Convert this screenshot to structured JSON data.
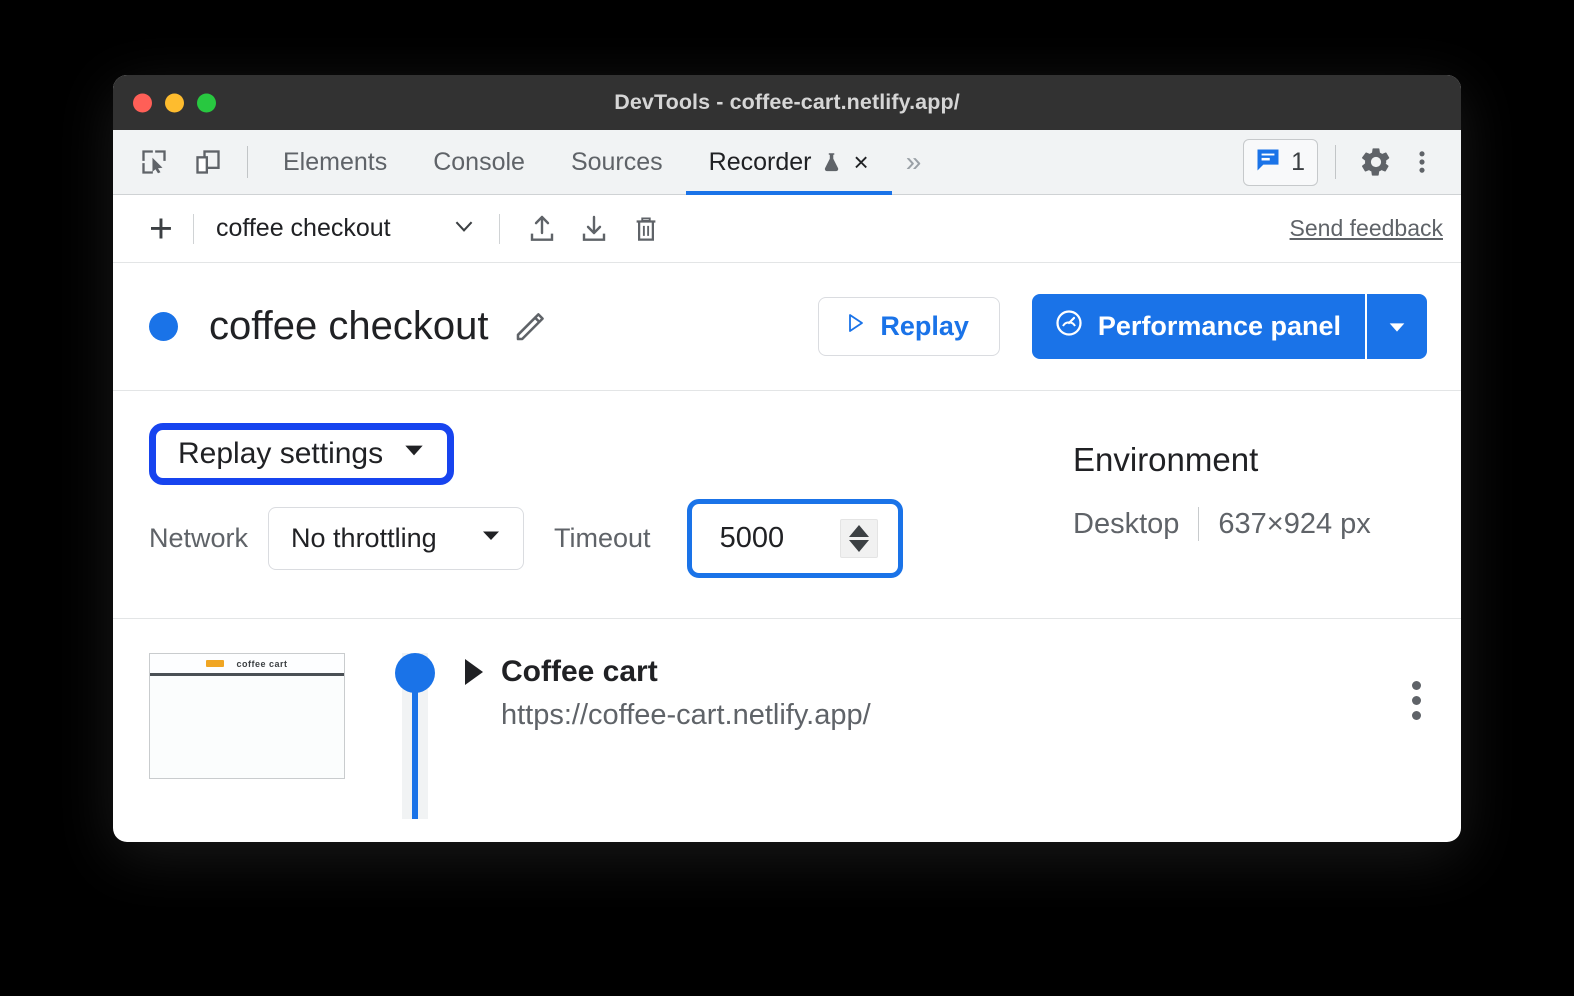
{
  "window": {
    "title": "DevTools - coffee-cart.netlify.app/",
    "traffic_lights": [
      "close",
      "minimize",
      "maximize"
    ]
  },
  "tabbar": {
    "inspect_icon": "inspect-cursor-icon",
    "device_icon": "device-toolbar-icon",
    "tabs": [
      {
        "label": "Elements",
        "active": false
      },
      {
        "label": "Console",
        "active": false
      },
      {
        "label": "Sources",
        "active": false
      },
      {
        "label": "Recorder",
        "active": true,
        "experimental": true,
        "closable": true
      }
    ],
    "more_tabs_label": "»",
    "close_label": "×",
    "issues_count": "1",
    "issues_icon": "issues-message-icon",
    "settings_icon": "gear-icon",
    "main_menu_icon": "kebab-menu-icon"
  },
  "recorder_toolbar": {
    "add_label": "+",
    "selected_recording": "coffee checkout",
    "dropdown_icon": "chevron-down-icon",
    "import_icon": "import-upload-icon",
    "export_icon": "export-download-icon",
    "delete_icon": "trash-icon",
    "feedback_label": "Send feedback"
  },
  "header": {
    "status_dot_color": "#1a73e8",
    "recording_name": "coffee checkout",
    "edit_icon": "pencil-edit-icon",
    "replay_label": "Replay",
    "replay_icon": "play-triangle-icon",
    "performance_label": "Performance panel",
    "performance_icon": "performance-gauge-icon",
    "performance_caret_icon": "caret-down-icon"
  },
  "settings": {
    "replay_settings_label": "Replay settings",
    "replay_settings_caret": "caret-down-icon",
    "replay_settings_highlight": "#1744ef",
    "network_label": "Network",
    "network_value": "No throttling",
    "network_caret": "caret-down-icon",
    "timeout_label": "Timeout",
    "timeout_value": "5000",
    "timeout_highlight": "#1a73e8",
    "timeout_spinner": "number-stepper-icon",
    "environment_title": "Environment",
    "environment_device": "Desktop",
    "environment_viewport": "637×924 px"
  },
  "steps": {
    "thumbnail_alt": "page-screenshot-thumbnail",
    "thumbnail_label": "coffee cart",
    "items": [
      {
        "title": "Coffee cart",
        "url": "https://coffee-cart.netlify.app/",
        "expand_icon": "expand-triangle-icon",
        "menu_icon": "kebab-menu-icon"
      }
    ]
  }
}
